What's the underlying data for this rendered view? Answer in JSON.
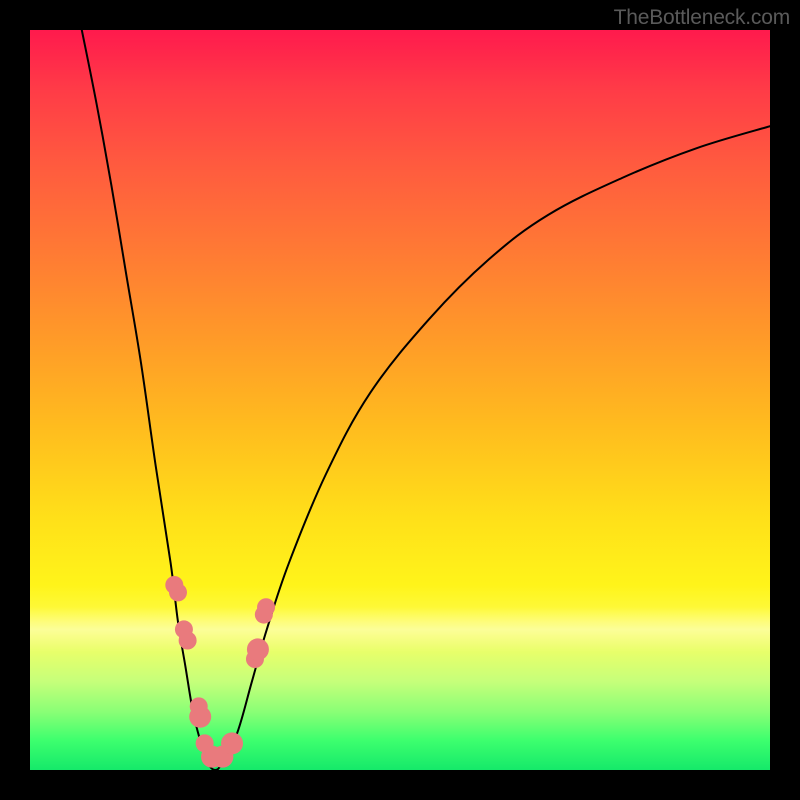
{
  "watermark": "TheBottleneck.com",
  "colors": {
    "marker": "#e97a7d",
    "curve": "#000000"
  },
  "chart_data": {
    "type": "line",
    "title": "",
    "xlabel": "",
    "ylabel": "",
    "xlim": [
      0,
      100
    ],
    "ylim": [
      0,
      100
    ],
    "grid": false,
    "legend": false,
    "series": [
      {
        "name": "left_curve",
        "x": [
          7,
          9,
          11,
          13,
          15,
          17,
          19,
          20,
          21,
          22,
          23,
          24
        ],
        "values": [
          100,
          90,
          79,
          67,
          55,
          41,
          28,
          20,
          14,
          8,
          4,
          1
        ]
      },
      {
        "name": "right_curve",
        "x": [
          26,
          28,
          30,
          32,
          35,
          40,
          46,
          54,
          62,
          70,
          80,
          90,
          100
        ],
        "values": [
          1,
          5,
          12,
          19,
          28,
          40,
          51,
          61,
          69,
          75,
          80,
          84,
          87
        ]
      },
      {
        "name": "bottom_join",
        "x": [
          24,
          25,
          26
        ],
        "values": [
          1,
          0,
          1
        ]
      }
    ],
    "markers": {
      "name": "data_points",
      "x": [
        19.5,
        20.0,
        20.8,
        21.3,
        22.8,
        23.0,
        23.6,
        24.6,
        26.0,
        27.3,
        30.4,
        30.8,
        31.6,
        31.9
      ],
      "values": [
        25.0,
        24.0,
        19.0,
        17.5,
        8.6,
        7.2,
        3.6,
        1.8,
        1.8,
        3.6,
        15.0,
        16.3,
        21.0,
        22.0
      ],
      "radius": [
        9,
        9,
        9,
        9,
        9,
        11,
        9,
        11,
        11,
        11,
        9,
        11,
        9,
        9
      ]
    }
  }
}
